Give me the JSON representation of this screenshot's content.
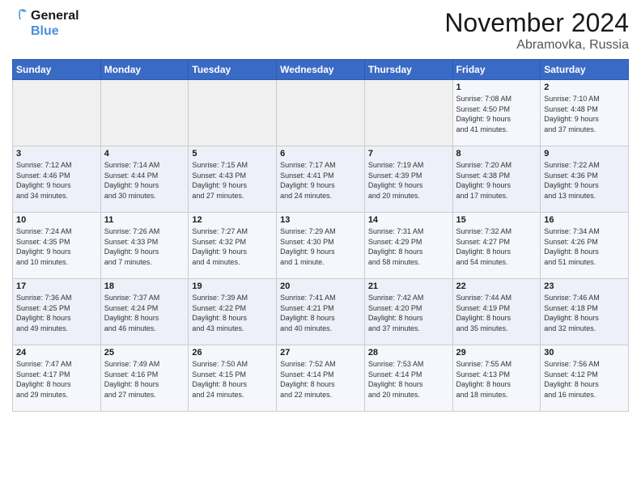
{
  "logo": {
    "line1": "General",
    "line2": "Blue"
  },
  "title": "November 2024",
  "location": "Abramovka, Russia",
  "weekdays": [
    "Sunday",
    "Monday",
    "Tuesday",
    "Wednesday",
    "Thursday",
    "Friday",
    "Saturday"
  ],
  "weeks": [
    [
      {
        "day": "",
        "info": ""
      },
      {
        "day": "",
        "info": ""
      },
      {
        "day": "",
        "info": ""
      },
      {
        "day": "",
        "info": ""
      },
      {
        "day": "",
        "info": ""
      },
      {
        "day": "1",
        "info": "Sunrise: 7:08 AM\nSunset: 4:50 PM\nDaylight: 9 hours\nand 41 minutes."
      },
      {
        "day": "2",
        "info": "Sunrise: 7:10 AM\nSunset: 4:48 PM\nDaylight: 9 hours\nand 37 minutes."
      }
    ],
    [
      {
        "day": "3",
        "info": "Sunrise: 7:12 AM\nSunset: 4:46 PM\nDaylight: 9 hours\nand 34 minutes."
      },
      {
        "day": "4",
        "info": "Sunrise: 7:14 AM\nSunset: 4:44 PM\nDaylight: 9 hours\nand 30 minutes."
      },
      {
        "day": "5",
        "info": "Sunrise: 7:15 AM\nSunset: 4:43 PM\nDaylight: 9 hours\nand 27 minutes."
      },
      {
        "day": "6",
        "info": "Sunrise: 7:17 AM\nSunset: 4:41 PM\nDaylight: 9 hours\nand 24 minutes."
      },
      {
        "day": "7",
        "info": "Sunrise: 7:19 AM\nSunset: 4:39 PM\nDaylight: 9 hours\nand 20 minutes."
      },
      {
        "day": "8",
        "info": "Sunrise: 7:20 AM\nSunset: 4:38 PM\nDaylight: 9 hours\nand 17 minutes."
      },
      {
        "day": "9",
        "info": "Sunrise: 7:22 AM\nSunset: 4:36 PM\nDaylight: 9 hours\nand 13 minutes."
      }
    ],
    [
      {
        "day": "10",
        "info": "Sunrise: 7:24 AM\nSunset: 4:35 PM\nDaylight: 9 hours\nand 10 minutes."
      },
      {
        "day": "11",
        "info": "Sunrise: 7:26 AM\nSunset: 4:33 PM\nDaylight: 9 hours\nand 7 minutes."
      },
      {
        "day": "12",
        "info": "Sunrise: 7:27 AM\nSunset: 4:32 PM\nDaylight: 9 hours\nand 4 minutes."
      },
      {
        "day": "13",
        "info": "Sunrise: 7:29 AM\nSunset: 4:30 PM\nDaylight: 9 hours\nand 1 minute."
      },
      {
        "day": "14",
        "info": "Sunrise: 7:31 AM\nSunset: 4:29 PM\nDaylight: 8 hours\nand 58 minutes."
      },
      {
        "day": "15",
        "info": "Sunrise: 7:32 AM\nSunset: 4:27 PM\nDaylight: 8 hours\nand 54 minutes."
      },
      {
        "day": "16",
        "info": "Sunrise: 7:34 AM\nSunset: 4:26 PM\nDaylight: 8 hours\nand 51 minutes."
      }
    ],
    [
      {
        "day": "17",
        "info": "Sunrise: 7:36 AM\nSunset: 4:25 PM\nDaylight: 8 hours\nand 49 minutes."
      },
      {
        "day": "18",
        "info": "Sunrise: 7:37 AM\nSunset: 4:24 PM\nDaylight: 8 hours\nand 46 minutes."
      },
      {
        "day": "19",
        "info": "Sunrise: 7:39 AM\nSunset: 4:22 PM\nDaylight: 8 hours\nand 43 minutes."
      },
      {
        "day": "20",
        "info": "Sunrise: 7:41 AM\nSunset: 4:21 PM\nDaylight: 8 hours\nand 40 minutes."
      },
      {
        "day": "21",
        "info": "Sunrise: 7:42 AM\nSunset: 4:20 PM\nDaylight: 8 hours\nand 37 minutes."
      },
      {
        "day": "22",
        "info": "Sunrise: 7:44 AM\nSunset: 4:19 PM\nDaylight: 8 hours\nand 35 minutes."
      },
      {
        "day": "23",
        "info": "Sunrise: 7:46 AM\nSunset: 4:18 PM\nDaylight: 8 hours\nand 32 minutes."
      }
    ],
    [
      {
        "day": "24",
        "info": "Sunrise: 7:47 AM\nSunset: 4:17 PM\nDaylight: 8 hours\nand 29 minutes."
      },
      {
        "day": "25",
        "info": "Sunrise: 7:49 AM\nSunset: 4:16 PM\nDaylight: 8 hours\nand 27 minutes."
      },
      {
        "day": "26",
        "info": "Sunrise: 7:50 AM\nSunset: 4:15 PM\nDaylight: 8 hours\nand 24 minutes."
      },
      {
        "day": "27",
        "info": "Sunrise: 7:52 AM\nSunset: 4:14 PM\nDaylight: 8 hours\nand 22 minutes."
      },
      {
        "day": "28",
        "info": "Sunrise: 7:53 AM\nSunset: 4:14 PM\nDaylight: 8 hours\nand 20 minutes."
      },
      {
        "day": "29",
        "info": "Sunrise: 7:55 AM\nSunset: 4:13 PM\nDaylight: 8 hours\nand 18 minutes."
      },
      {
        "day": "30",
        "info": "Sunrise: 7:56 AM\nSunset: 4:12 PM\nDaylight: 8 hours\nand 16 minutes."
      }
    ]
  ]
}
